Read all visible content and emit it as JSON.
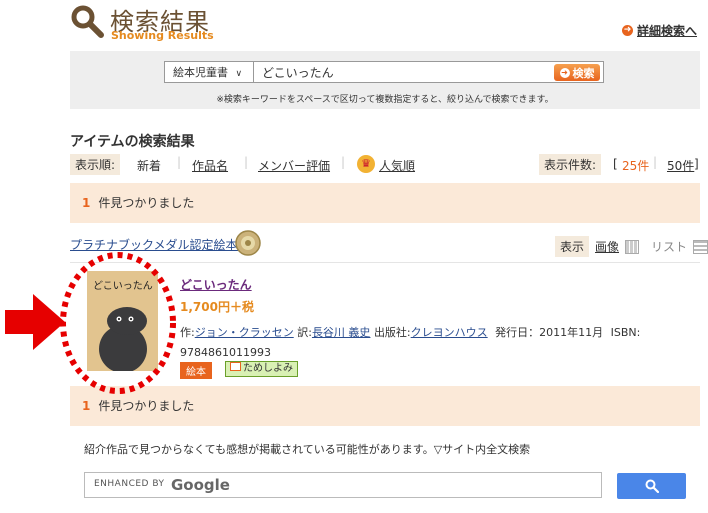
{
  "header": {
    "title": "検索結果",
    "subtitle": "Showing Results",
    "advanced_search_label": "詳細検索へ"
  },
  "search": {
    "category_selected": "絵本児童書",
    "query_value": "どこいったん",
    "button_label": "検索",
    "note": "※検索キーワードをスペースで区切って複数指定すると、絞り込んで検索できます。"
  },
  "results": {
    "title": "アイテムの検索結果",
    "sort_label": "表示順:",
    "sort_options": [
      "新着",
      "作品名",
      "メンバー評価",
      "人気順"
    ],
    "per_page_label": "表示件数:",
    "per_page_options": [
      "25件",
      "50件"
    ],
    "count_number": "1",
    "count_text": "件見つかりました",
    "platinum_link": "プラチナブックメダル認定絵本:",
    "view_label": "表示",
    "view_image": "画像",
    "view_list": "リスト"
  },
  "item": {
    "cover_title": "どこいったん",
    "title": "どこいったん",
    "price": "1,700円＋税",
    "author_prefix": "作:",
    "author": "ジョン・クラッセン",
    "translator_prefix": "訳:",
    "translator": "長谷川 義史",
    "publisher_prefix": "出版社:",
    "publisher": "クレヨンハウス",
    "release": "発行日：2011年11月",
    "isbn_label": "ISBN:",
    "isbn": "9784861011993",
    "tag_genre": "絵本",
    "tag_trial": "ためしよみ"
  },
  "footer": {
    "note": "紹介作品で見つからなくても感想が掲載されている可能性があります。▽サイト内全文検索",
    "google_label": "ENHANCED BY",
    "google_word": "Google"
  },
  "colors": {
    "accent_orange": "#e8641e",
    "band_peach": "#fbe9d8",
    "title_brown": "#6b5133",
    "annotation_red": "#e60000",
    "google_blue": "#4a86e8"
  }
}
